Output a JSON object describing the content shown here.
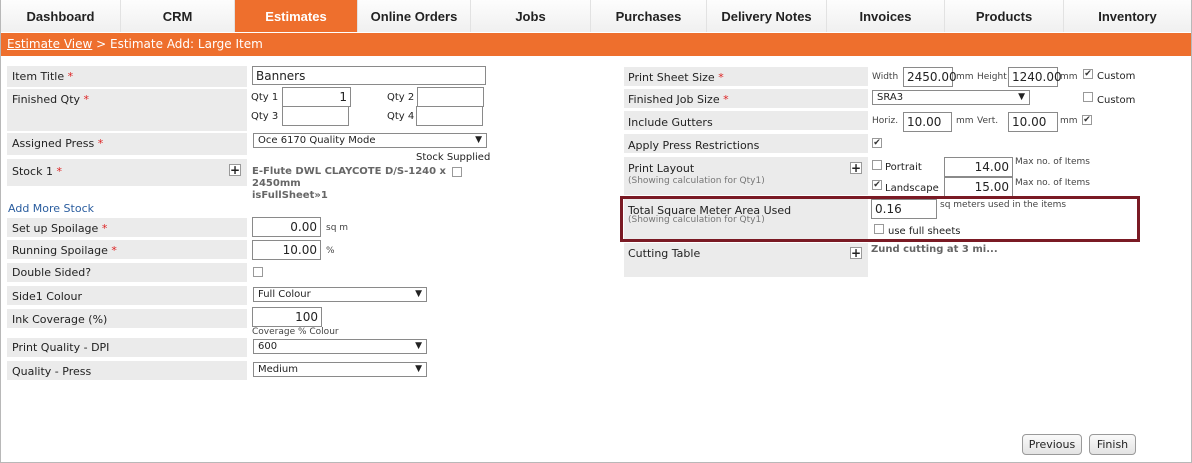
{
  "nav": {
    "tabs": [
      "Dashboard",
      "CRM",
      "Estimates",
      "Online Orders",
      "Jobs",
      "Purchases",
      "Delivery Notes",
      "Invoices",
      "Products",
      "Inventory"
    ]
  },
  "breadcrumb": {
    "link": "Estimate View",
    "current": "> Estimate Add: Large Item"
  },
  "left": {
    "item_title": {
      "label": "Item Title",
      "value": "Banners"
    },
    "finished_qty": {
      "label": "Finished Qty",
      "qty1_label": "Qty 1",
      "qty1": "1",
      "qty2_label": "Qty 2",
      "qty2": "",
      "qty3_label": "Qty 3",
      "qty3": "",
      "qty4_label": "Qty 4",
      "qty4": ""
    },
    "assigned_press": {
      "label": "Assigned Press",
      "value": "Oce 6170 Quality Mode"
    },
    "stock": {
      "label": "Stock 1",
      "supplied_label": "Stock Supplied",
      "line1": "E-Flute DWL CLAYCOTE D/S-1240 x",
      "line2": "2450mm",
      "line3": "isFullSheet»1"
    },
    "add_more_stock": "Add More Stock",
    "setup_spoilage": {
      "label": "Set up Spoilage",
      "value": "0.00",
      "unit": "sq m"
    },
    "running_spoilage": {
      "label": "Running Spoilage",
      "value": "10.00",
      "unit": "%"
    },
    "double_sided": {
      "label": "Double Sided?"
    },
    "side1_colour": {
      "label": "Side1 Colour",
      "value": "Full Colour"
    },
    "ink_coverage": {
      "label": "Ink Coverage (%)",
      "value": "100",
      "note": "Coverage % Colour"
    },
    "print_quality": {
      "label": "Print Quality - DPI",
      "value": "600"
    },
    "quality_press": {
      "label": "Quality - Press",
      "value": "Medium"
    }
  },
  "right": {
    "print_sheet_size": {
      "label": "Print Sheet Size",
      "width_label": "Width",
      "width": "2450.00",
      "unit": "mm",
      "height_label": "Height",
      "height": "1240.00",
      "custom": "Custom"
    },
    "finished_job_size": {
      "label": "Finished Job Size",
      "value": "SRA3",
      "custom": "Custom"
    },
    "include_gutters": {
      "label": "Include Gutters",
      "horiz_label": "Horiz.",
      "horiz": "10.00",
      "vert_label": "Vert.",
      "vert": "10.00",
      "unit": "mm"
    },
    "apply_press": {
      "label": "Apply Press Restrictions"
    },
    "print_layout": {
      "label": "Print Layout",
      "note": "(Showing calculation for Qty1)",
      "portrait": "Portrait",
      "portrait_value": "14.00",
      "landscape": "Landscape",
      "landscape_value": "15.00",
      "max_label": "Max no. of Items"
    },
    "total_area": {
      "label": "Total Square Meter Area Used",
      "note": "(Showing calculation for Qty1)",
      "value": "0.16",
      "suffix": "sq meters used in the items",
      "full_sheets": "use full sheets"
    },
    "cutting_table": {
      "label": "Cutting Table",
      "value": "Zund cutting at 3 mi..."
    }
  },
  "buttons": {
    "previous": "Previous",
    "finish": "Finish"
  },
  "colors": {
    "accent": "#ee6f2d",
    "highlight": "#7a1a24"
  }
}
